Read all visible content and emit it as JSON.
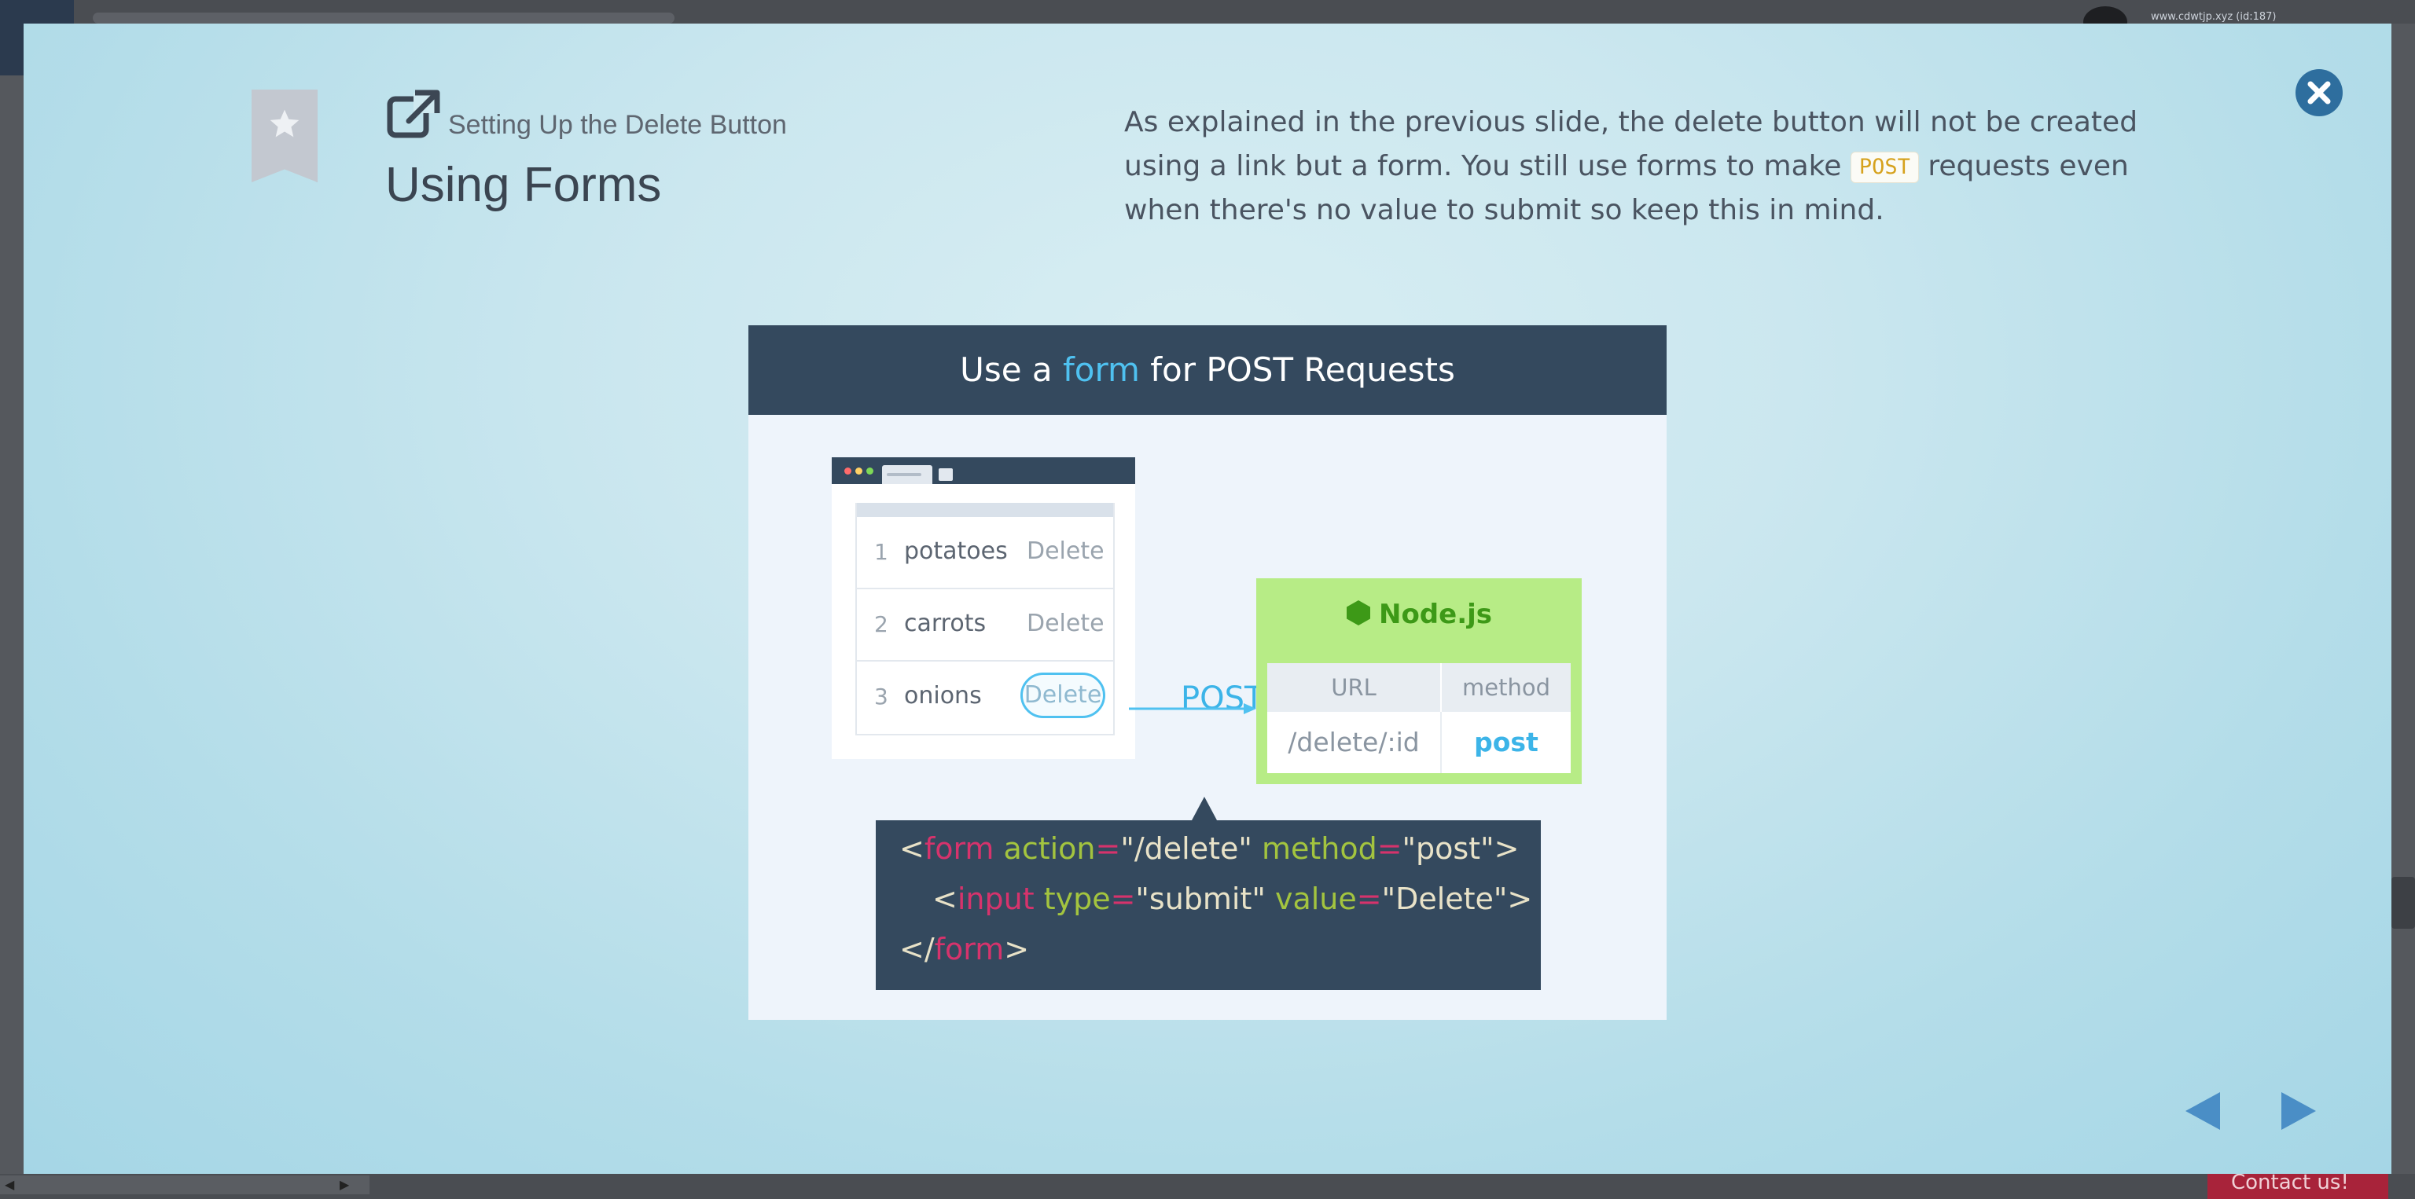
{
  "background": {
    "user_text": "www.cdwtjp.xyz (id:187)",
    "contact_label": "Contact us!",
    "scroll_left_label": "◀",
    "scroll_right_label": "▶"
  },
  "header": {
    "bookmark_icon": "bookmark-star-icon",
    "external_link_icon": "external-link-icon",
    "subtitle": "Setting Up the Delete Button",
    "title": "Using Forms",
    "description_part1": "As explained in the previous slide, the delete button will not be created using a link but a form. You still use forms to make ",
    "description_code": "POST",
    "description_part2": " requests even when there's no value to submit so keep this in mind.",
    "close_icon": "close-icon"
  },
  "slide": {
    "title_pre": "Use a ",
    "title_highlight": "form",
    "title_post": " for POST Requests",
    "list": [
      {
        "num": "1",
        "name": "potatoes",
        "action": "Delete"
      },
      {
        "num": "2",
        "name": "carrots",
        "action": "Delete"
      },
      {
        "num": "3",
        "name": "onions",
        "action": "Delete"
      }
    ],
    "post_label": "POST",
    "node_title": "Node.js",
    "node_table": {
      "headers": [
        "URL",
        "method"
      ],
      "row": [
        "/delete/:id",
        "post"
      ]
    },
    "code": {
      "line1": {
        "lt": "<",
        "tag": "form",
        "attr1": "action",
        "eq1": "=",
        "val1": "\"/delete\"",
        "attr2": "method",
        "eq2": "=",
        "val2": "\"post\"",
        "gt": ">"
      },
      "line2": {
        "lt": "<",
        "tag": "input",
        "attr1": "type",
        "eq1": "=",
        "val1": "\"submit\"",
        "attr2": "value",
        "eq2": "=",
        "val2": "\"Delete\"",
        "gt": ">"
      },
      "line3": {
        "lt": "</",
        "tag": "form",
        "gt": ">"
      }
    },
    "colors": {
      "header_bg": "#34495e",
      "highlight": "#4fc1f0",
      "node_bg": "#b7ec86",
      "node_green": "#3d9917",
      "code_tag": "#d6336c",
      "code_attr": "#a3c43f"
    }
  },
  "navigation": {
    "prev_icon": "prev-arrow-icon",
    "next_icon": "next-arrow-icon"
  }
}
